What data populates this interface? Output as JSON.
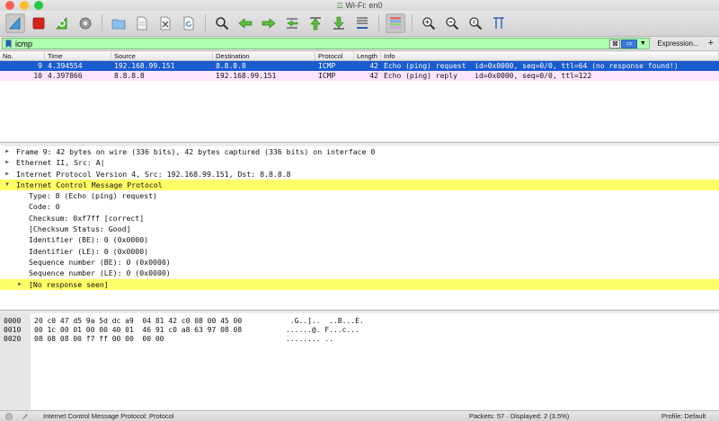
{
  "window": {
    "title": "Wi-Fi: en0"
  },
  "toolbar": {
    "buttons": [
      {
        "name": "start-capture",
        "icon": "shark-fin-icon"
      },
      {
        "name": "stop-capture",
        "icon": "stop-icon"
      },
      {
        "name": "restart-capture",
        "icon": "restart-icon"
      },
      {
        "name": "capture-options",
        "icon": "gear-icon"
      },
      {
        "name": "open-file",
        "icon": "folder-icon"
      },
      {
        "name": "save-file",
        "icon": "file-icon"
      },
      {
        "name": "close-file",
        "icon": "close-file-icon"
      },
      {
        "name": "reload-file",
        "icon": "reload-icon"
      },
      {
        "name": "find-packet",
        "icon": "search-icon"
      },
      {
        "name": "go-back",
        "icon": "arrow-left-icon"
      },
      {
        "name": "go-forward",
        "icon": "arrow-right-icon"
      },
      {
        "name": "go-to-packet",
        "icon": "jump-icon"
      },
      {
        "name": "go-first",
        "icon": "first-packet-icon"
      },
      {
        "name": "go-last",
        "icon": "last-packet-icon"
      },
      {
        "name": "autoscroll",
        "icon": "autoscroll-icon"
      },
      {
        "name": "colorize",
        "icon": "colorize-icon"
      },
      {
        "name": "zoom-in",
        "icon": "zoom-in-icon"
      },
      {
        "name": "zoom-out",
        "icon": "zoom-out-icon"
      },
      {
        "name": "zoom-normal",
        "icon": "zoom-normal-icon"
      },
      {
        "name": "resize-columns",
        "icon": "resize-columns-icon"
      }
    ]
  },
  "filter": {
    "value": "icmp",
    "clear_label": "⊠",
    "apply_label": "⇨",
    "expression_label": "Expression...",
    "add_label": "+"
  },
  "packet_list": {
    "columns": [
      "No.",
      "Time",
      "Source",
      "Destination",
      "Protocol",
      "Length",
      "Info"
    ],
    "rows": [
      {
        "no": "9",
        "time": "4.394554",
        "src": "192.168.99.151",
        "dst": "8.8.8.8",
        "proto": "ICMP",
        "len": "42",
        "info": "Echo (ping) request  id=0x0000, seq=0/0, ttl=64 (no response found!)"
      },
      {
        "no": "10",
        "time": "4.397866",
        "src": "8.8.8.8",
        "dst": "192.168.99.151",
        "proto": "ICMP",
        "len": "42",
        "info": "Echo (ping) reply    id=0x0000, seq=0/0, ttl=122"
      }
    ]
  },
  "details": {
    "rows": [
      {
        "text": "Frame 9: 42 bytes on wire (336 bits), 42 bytes captured (336 bits) on interface 0",
        "level": 0,
        "arrow": "▶"
      },
      {
        "text": "Ethernet II, Src: A|",
        "level": 0,
        "arrow": "▶"
      },
      {
        "text": "Internet Protocol Version 4, Src: 192.168.99.151, Dst: 8.8.8.8",
        "level": 0,
        "arrow": "▶"
      },
      {
        "text": "Internet Control Message Protocol",
        "level": 0,
        "arrow": "▼"
      },
      {
        "text": "Type: 8 (Echo (ping) request)",
        "level": 1,
        "arrow": ""
      },
      {
        "text": "Code: 0",
        "level": 1,
        "arrow": ""
      },
      {
        "text": "Checksum: 0xf7ff [correct]",
        "level": 1,
        "arrow": ""
      },
      {
        "text": "[Checksum Status: Good]",
        "level": 1,
        "arrow": ""
      },
      {
        "text": "Identifier (BE): 0 (0x0000)",
        "level": 1,
        "arrow": ""
      },
      {
        "text": "Identifier (LE): 0 (0x0000)",
        "level": 1,
        "arrow": ""
      },
      {
        "text": "Sequence number (BE): 0 (0x0000)",
        "level": 1,
        "arrow": ""
      },
      {
        "text": "Sequence number (LE): 0 (0x0000)",
        "level": 1,
        "arrow": ""
      },
      {
        "text": "[No response seen]",
        "level": 1,
        "arrow": "▶"
      }
    ]
  },
  "bytes": {
    "rows": [
      {
        "offset": "0000",
        "hex": "20 c0 47 d5 9a 5d dc a9  04 81 42 c0 08 00 45 00",
        "ascii": " .G..]..  ..B...E."
      },
      {
        "offset": "0010",
        "hex": "00 1c 00 01 00 00 40 01  46 91 c0 a8 63 97 08 08",
        "ascii": "......@. F...c..."
      },
      {
        "offset": "0020",
        "hex": "08 08 08 00 f7 ff 00 00  00 00",
        "ascii": "........ .."
      }
    ]
  },
  "status": {
    "text": "Internet Control Message Protocol: Protocol",
    "packets": "Packets: 57 · Displayed: 2 (3.5%)",
    "profile": "Profile: Default"
  },
  "colors": {
    "selected_row": "#1a5cce",
    "reply_row": "#fde4f8",
    "filter_ok": "#afffaf",
    "highlight": "#ffff66"
  }
}
